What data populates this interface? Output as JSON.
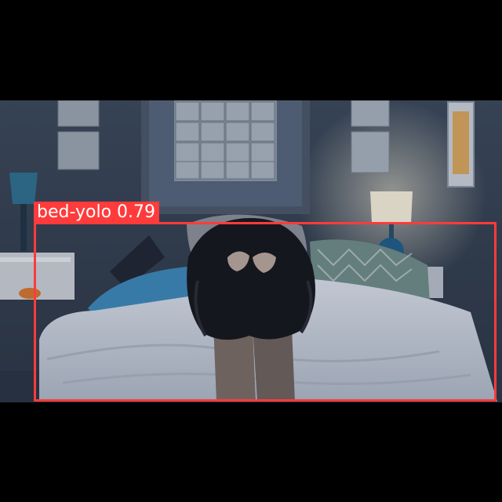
{
  "detections": [
    {
      "label": "bed-yolo 0.79",
      "color": "#ff3b3b"
    }
  ]
}
